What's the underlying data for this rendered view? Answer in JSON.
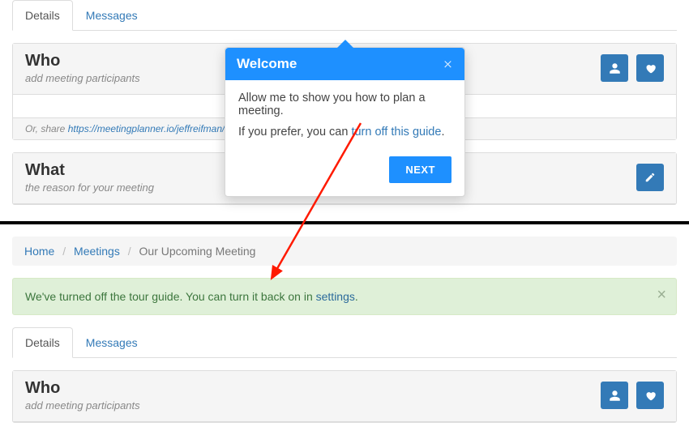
{
  "tabs": {
    "details": "Details",
    "messages": "Messages"
  },
  "panels": {
    "who": {
      "title": "Who",
      "subtitle": "add meeting participants",
      "share_prefix": "Or, share ",
      "share_url": "https://meetingplanner.io/jeffreifman/4Idx"
    },
    "what": {
      "title": "What",
      "subtitle": "the reason for your meeting"
    }
  },
  "popover": {
    "title": "Welcome",
    "line1": "Allow me to show you how to plan a meeting.",
    "line2_prefix": "If you prefer, you can ",
    "line2_link": "turn off this guide",
    "line2_suffix": ".",
    "next": "NEXT"
  },
  "breadcrumb": {
    "home": "Home",
    "meetings": "Meetings",
    "current": "Our Upcoming Meeting"
  },
  "alert": {
    "text_prefix": "We've turned off the tour guide. You can turn it back on in ",
    "link": "settings",
    "text_suffix": "."
  }
}
